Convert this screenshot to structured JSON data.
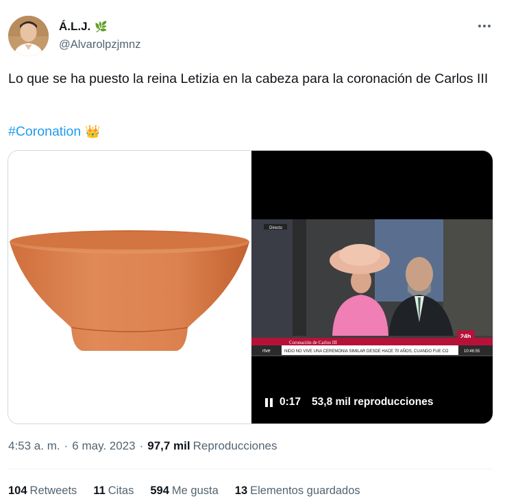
{
  "author": {
    "display_name": "Á.L.J.",
    "name_emoji": "🌿",
    "handle": "@Alvarolpzjmnz"
  },
  "tweet": {
    "text": "Lo que se ha puesto la reina Letizia en la cabeza para la coronación de Carlos III",
    "hashtag": "#Coronation",
    "hashtag_emoji": "👑"
  },
  "media": {
    "video": {
      "elapsed": "0:17",
      "views": "53,8 mil reproducciones",
      "overlay": {
        "live_label": "Directo",
        "channel_badge": "24h",
        "banner_title": "Coronación de Carlos III",
        "ticker_brand": "rtve",
        "ticker_text": "NIDO NO VIVE UNA CEREMONIA SIMILAR DESDE HACE 70 AÑOS, CUANDO FUE CO",
        "ticker_time": "10:46:55"
      }
    }
  },
  "meta": {
    "time": "4:53 a. m.",
    "dot": "·",
    "date": "6 may. 2023",
    "views_count": "97,7 mil",
    "views_label": "Reproducciones"
  },
  "stats": [
    {
      "count": "104",
      "label": "Retweets"
    },
    {
      "count": "11",
      "label": "Citas"
    },
    {
      "count": "594",
      "label": "Me gusta"
    },
    {
      "count": "13",
      "label": "Elementos guardados"
    }
  ],
  "colors": {
    "link": "#1d9bf0",
    "secondary_text": "#536471",
    "pot": "#d9824f",
    "banner": "#b5123a"
  }
}
